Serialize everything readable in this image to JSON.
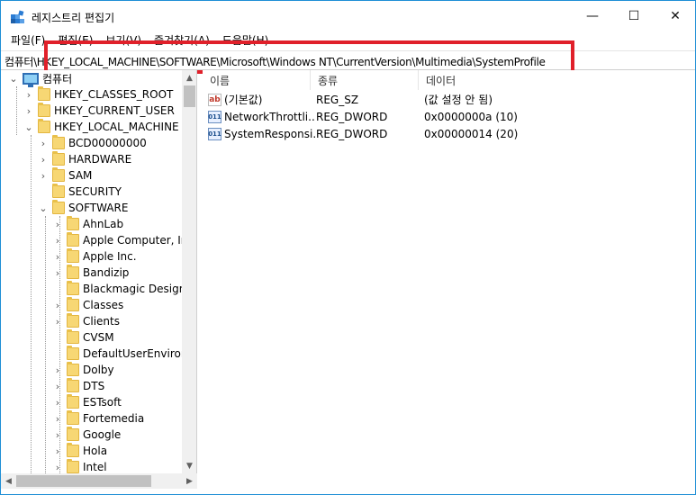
{
  "window": {
    "title": "레지스트리 편집기",
    "controls": {
      "minimize": "—",
      "maximize": "☐",
      "close": "✕"
    }
  },
  "menu": [
    "파일(F)",
    "편집(E)",
    "보기(V)",
    "즐겨찾기(A)",
    "도움말(H)"
  ],
  "address": "컴퓨터\\HKEY_LOCAL_MACHINE\\SOFTWARE\\Microsoft\\Windows NT\\CurrentVersion\\Multimedia\\SystemProfile",
  "highlight_color": "#e0202a",
  "tree": {
    "root": "컴퓨터",
    "hives": [
      "HKEY_CLASSES_ROOT",
      "HKEY_CURRENT_USER",
      "HKEY_LOCAL_MACHINE"
    ],
    "hklm_children": [
      "BCD00000000",
      "HARDWARE",
      "SAM",
      "SECURITY",
      "SOFTWARE"
    ],
    "software_children": [
      "AhnLab",
      "Apple Computer, Inc.",
      "Apple Inc.",
      "Bandizip",
      "Blackmagic Design",
      "Classes",
      "Clients",
      "CVSM",
      "DefaultUserEnvironment",
      "Dolby",
      "DTS",
      "ESTsoft",
      "Fortemedia",
      "Google",
      "Hola",
      "Intel"
    ]
  },
  "list": {
    "columns": [
      "이름",
      "종류",
      "데이터"
    ],
    "rows": [
      {
        "name": "(기본값)",
        "type": "REG_SZ",
        "data": "(값 설정 안 됨)",
        "icon": "string-value-icon"
      },
      {
        "name": "NetworkThrottli...",
        "type": "REG_DWORD",
        "data": "0x0000000a (10)",
        "icon": "dword-value-icon"
      },
      {
        "name": "SystemResponsi...",
        "type": "REG_DWORD",
        "data": "0x00000014 (20)",
        "icon": "dword-value-icon"
      }
    ]
  }
}
